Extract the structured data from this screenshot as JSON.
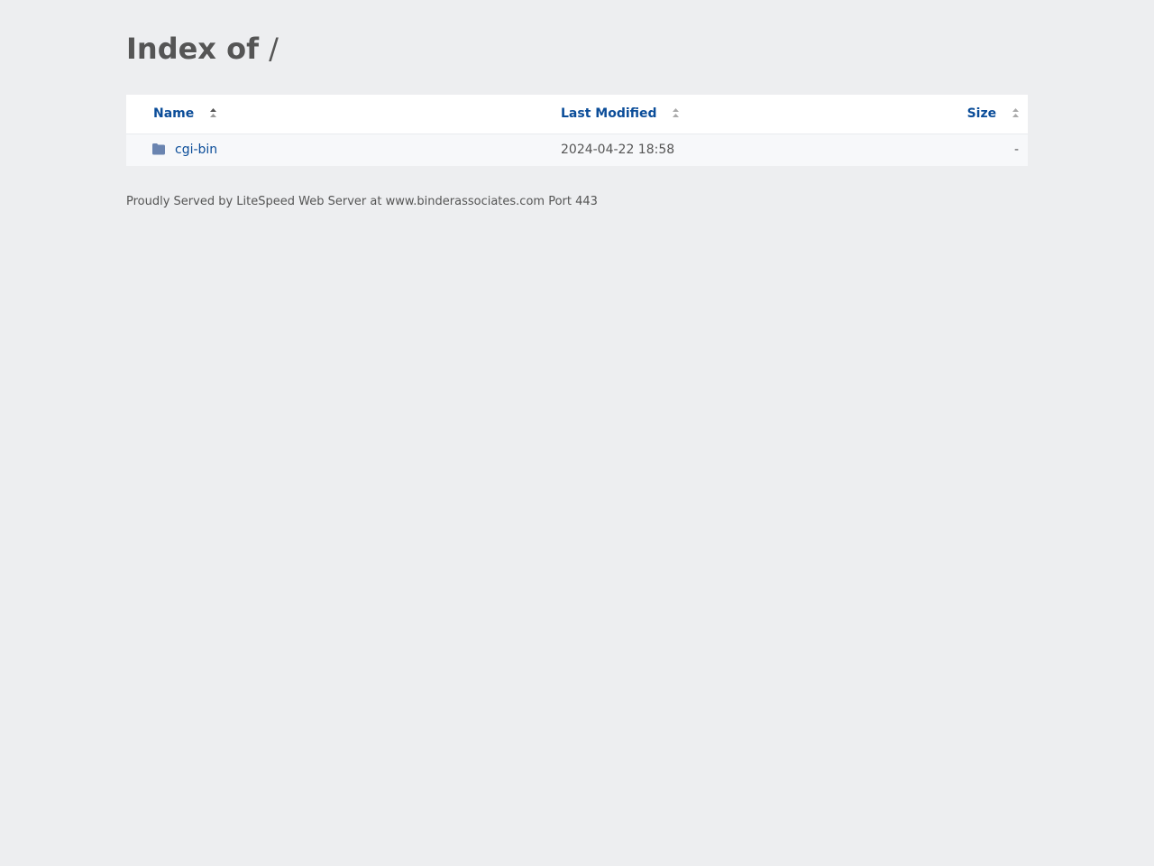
{
  "page": {
    "title": "Index of",
    "path": "/"
  },
  "table": {
    "columns": [
      {
        "label": "Name",
        "sort_icon": "sort-asc-icon"
      },
      {
        "label": "Last Modified",
        "sort_icon": "sort-icon"
      },
      {
        "label": "Size",
        "sort_icon": "sort-icon"
      }
    ],
    "rows": [
      {
        "icon": "folder-icon",
        "name": "cgi-bin",
        "modified": "2024-04-22 18:58",
        "size": "-"
      }
    ]
  },
  "footer": {
    "text": "Proudly Served by LiteSpeed Web Server at www.binderassociates.com Port 443"
  },
  "colors": {
    "link": "#0b4d99",
    "folder": "#6a84b0",
    "background": "#edeef0"
  }
}
